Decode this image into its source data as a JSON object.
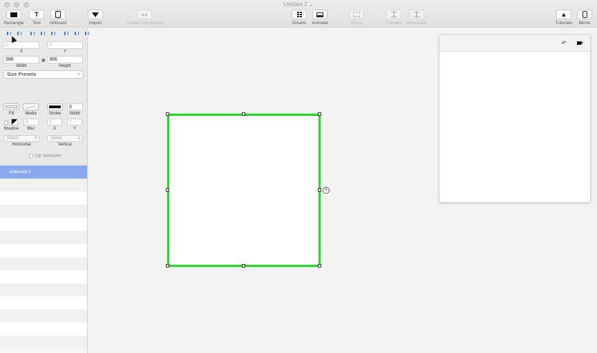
{
  "window": {
    "title": "Untitled 2 ⌄"
  },
  "toolbar": {
    "rectangle": "Rectangle",
    "text": "Text",
    "text_icon": "T",
    "artboard": "Artboard",
    "import": "Import",
    "create_component": "Create Component",
    "drivers": "Drivers",
    "animate": "Animate",
    "group": "Group",
    "forward": "Forward",
    "backward": "Backward",
    "tutorials": "Tutorials",
    "mirror": "Mirror"
  },
  "inspector": {
    "x_value": "0",
    "y_value": "0",
    "x_label": "X",
    "y_label": "Y",
    "width_value": "366",
    "height_value": "366",
    "width_label": "Width",
    "height_label": "Height",
    "size_presets": "Size Presets",
    "fill_label": "Fill",
    "media_label": "Media",
    "stroke_label": "Stroke",
    "stroke_width_label": "Width",
    "stroke_width_value": "0",
    "shadow_label": "Shadow",
    "blur_label": "Blur",
    "blur_value": "4",
    "shadow_x_value": "0",
    "shadow_y_value": "2",
    "shadow_x_label": "X",
    "shadow_y_label": "Y",
    "horizontal_value": "Static",
    "vertical_value": "Static",
    "horizontal_label": "Horizontal",
    "vertical_label": "Vertical",
    "clip_sublayers": "Clip Sublayers"
  },
  "layers": [
    {
      "label": "Artboard 1",
      "selected": true
    }
  ],
  "canvas": {
    "artboard_border_color": "#2bd62b",
    "bolt_icon": "ϟ"
  },
  "preview": {
    "undo_icon": "↶"
  }
}
